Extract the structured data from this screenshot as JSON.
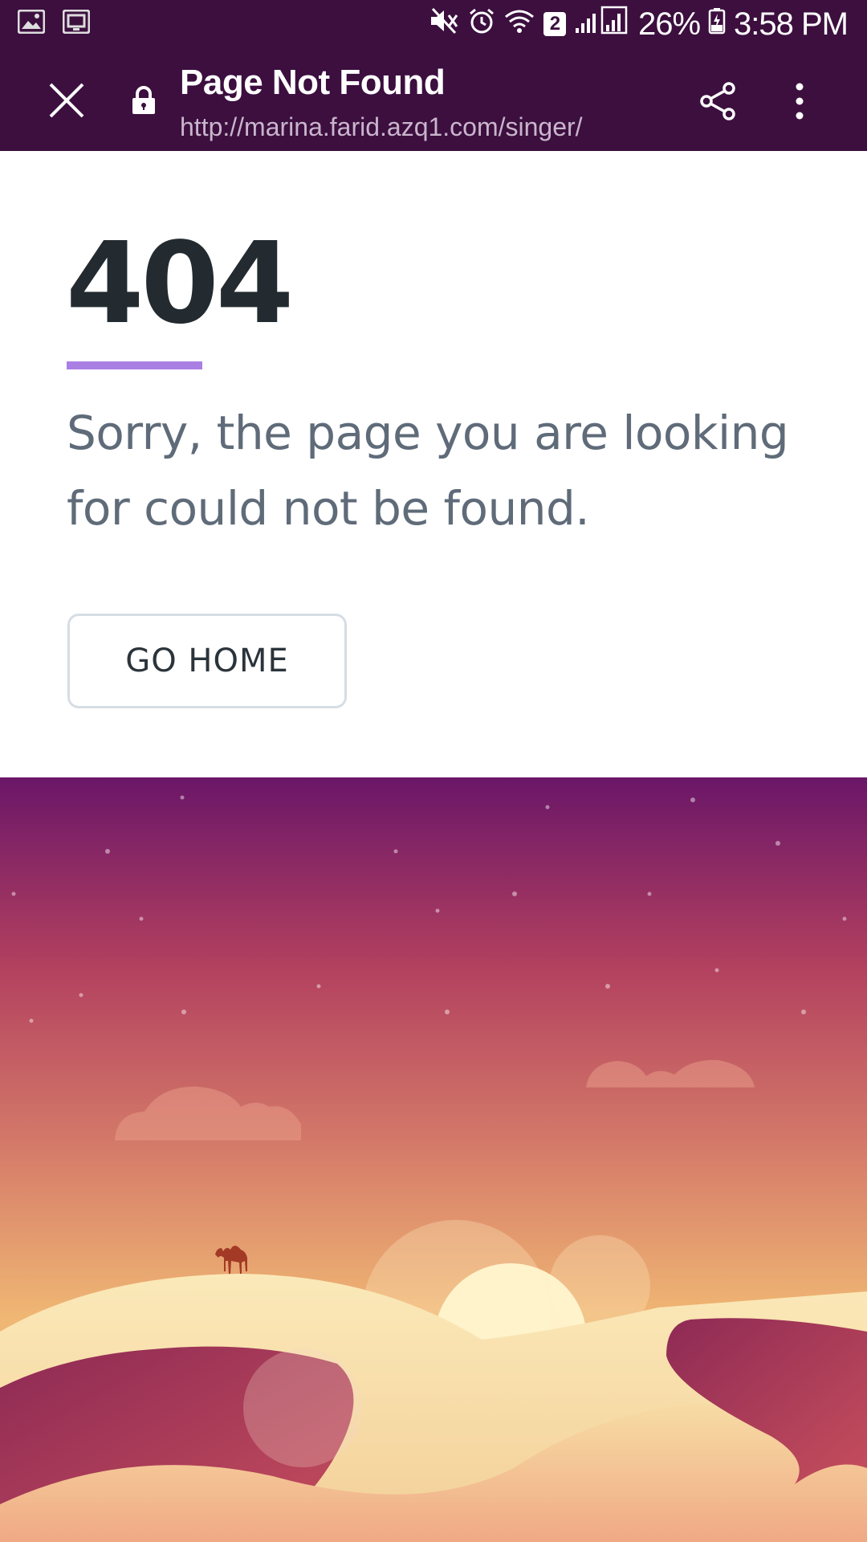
{
  "status_bar": {
    "time": "3:58 PM",
    "battery_percent": "26%",
    "sim_badge": "2",
    "left_icons": [
      "gallery-icon",
      "screenshot-icon"
    ],
    "right_icons": [
      "mute-icon",
      "alarm-icon",
      "wifi-icon",
      "signal-icon",
      "battery-icon"
    ]
  },
  "browser": {
    "page_title": "Page Not Found",
    "url": "http://marina.farid.azq1.com/singer/",
    "icons": [
      "close-icon",
      "lock-icon",
      "share-icon",
      "more-vert-icon"
    ]
  },
  "error": {
    "code": "404",
    "message": "Sorry, the page you are looking for could not be found.",
    "home_button_label": "GO HOME"
  },
  "colors": {
    "toolbar_bg": "#3c0f3f",
    "accent_underline": "#a97fe3",
    "heading_text": "#232b30",
    "message_text": "#5f6b79",
    "sky_top": "#6b1668",
    "sky_bottom": "#efb573",
    "dune_red": "#a83a5a",
    "dune_sand": "#f7dca4"
  },
  "illustration": {
    "subject": "desert sunset with camel on dunes",
    "icons": [
      "camel-icon",
      "sun-icon",
      "cloud-icon"
    ]
  }
}
